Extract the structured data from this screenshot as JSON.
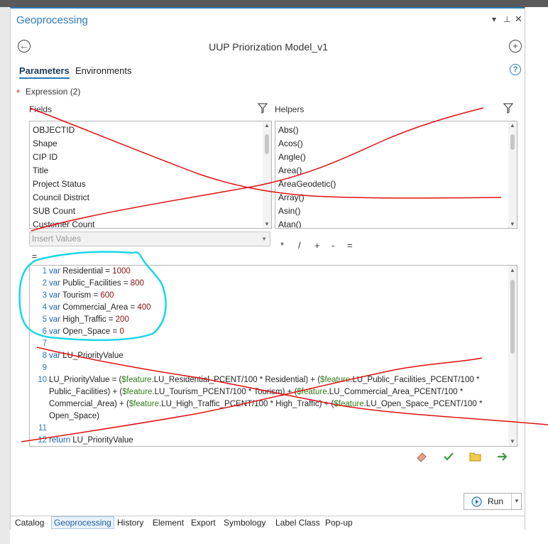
{
  "pane": {
    "title": "Geoprocessing",
    "tool_name": "UUP Priorization Model_v1",
    "tabs": {
      "parameters": "Parameters",
      "environments": "Environments"
    },
    "help": "?"
  },
  "expression": {
    "label": "Expression (2)",
    "fields_label": "Fields",
    "helpers_label": "Helpers",
    "fields": [
      "OBJECTID",
      "Shape",
      "CIP ID",
      "Title",
      "Project Status",
      "Council District",
      "SUB Count",
      "Customer Count"
    ],
    "helpers": [
      "Abs()",
      "Acos()",
      "Angle()",
      "Area()",
      "AreaGeodetic()",
      "Array()",
      "Asin()",
      "Atan()"
    ],
    "insert_values_placeholder": "Insert Values",
    "operators": [
      "*",
      "/",
      "+",
      "-",
      "="
    ],
    "equals": "="
  },
  "code": {
    "line_numbers": [
      "1",
      "2",
      "3",
      "4",
      "5",
      "6",
      "7",
      "8",
      "9",
      "10",
      "11",
      "12"
    ],
    "keyword": "var",
    "vars": [
      {
        "name": "Residential",
        "value": "1000"
      },
      {
        "name": "Public_Facilities",
        "value": "800"
      },
      {
        "name": "Tourism",
        "value": "600"
      },
      {
        "name": "Commercial_Area",
        "value": "400"
      },
      {
        "name": "High_Traffic",
        "value": "200"
      },
      {
        "name": "Open_Space",
        "value": "0"
      }
    ],
    "line8_name": "LU_PriorityValue",
    "feat": "$feature",
    "l10_a": "LU_PriorityValue = (",
    "l10_b": ".LU_Residential_PCENT/100 * Residential) + (",
    "l10_c": ".LU_Public_Facilities_PCENT/100 *",
    "l10_d": "Public_Facilities) + (",
    "l10_e": ".LU_Tourism_PCENT/100 * Tourism) + (",
    "l10_f": ".LU_Commercial_Area_PCENT/100 *",
    "l10_g": "Commercial_Area) + (",
    "l10_h": ".LU_High_Traffic_PCENT/100 * High_Traffic) + (",
    "l10_i": ".LU_Open_Space_PCENT/100 *",
    "l10_j": "Open_Space)",
    "return_kw": "return",
    "return_val": "LU_PriorityValue"
  },
  "actions": {
    "run_label": "Run"
  },
  "bottom_tabs": [
    "Catalog",
    "Geoprocessing",
    "History",
    "Element",
    "Export",
    "Symbology",
    "Label Class",
    "Pop-up"
  ],
  "colors": {
    "accent": "#2a7ab8",
    "annotation_red": "#e01010",
    "annotation_cyan": "#19d6e8",
    "run_green": "#3a9d3a"
  }
}
